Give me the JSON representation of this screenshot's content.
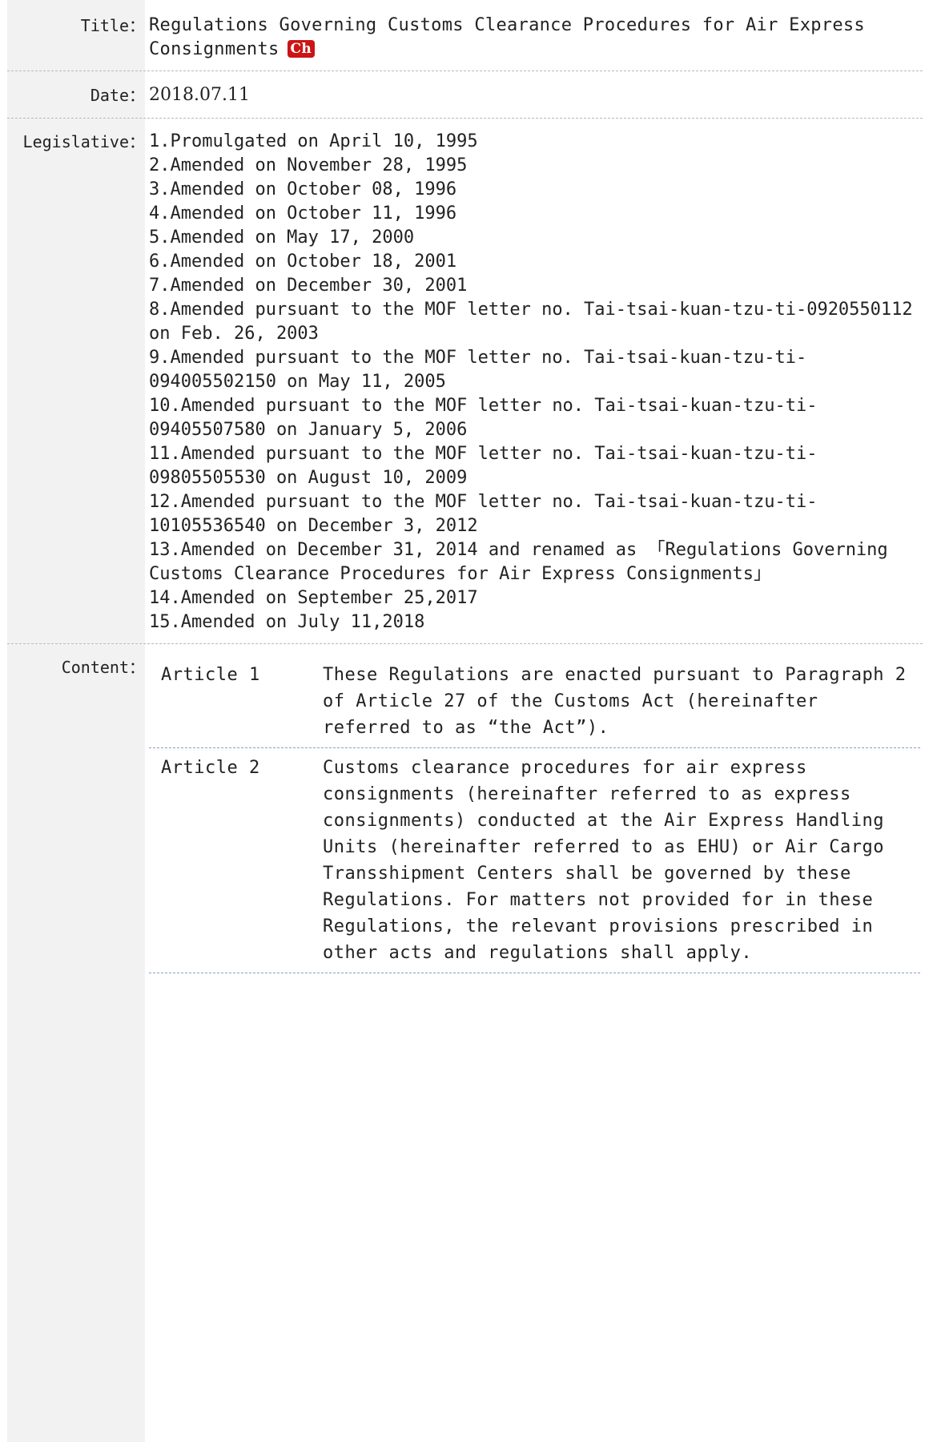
{
  "title": {
    "label": "Title：",
    "value": "Regulations Governing Customs Clearance Procedures for Air Express Consignments",
    "badge": "Ch",
    "badge_color": "#cc1414"
  },
  "date": {
    "label": "Date：",
    "value": "2018.07.11"
  },
  "legislative": {
    "label": "Legislative：",
    "items": [
      "1.Promulgated on April 10, 1995",
      "2.Amended on November 28, 1995",
      "3.Amended on October 08, 1996",
      "4.Amended on October 11, 1996",
      "5.Amended on May 17, 2000",
      "6.Amended on October 18, 2001",
      "7.Amended on December 30, 2001",
      "8.Amended pursuant to the MOF letter no. Tai-tsai-kuan-tzu-ti-0920550112 on Feb. 26, 2003",
      "9.Amended pursuant to the MOF letter no. Tai-tsai-kuan-tzu-ti-094005502150 on May 11, 2005",
      "10.Amended pursuant to the MOF letter no. Tai-tsai-kuan-tzu-ti-09405507580 on January 5, 2006",
      "11.Amended pursuant to the MOF letter no. Tai-tsai-kuan-tzu-ti-09805505530 on August 10, 2009",
      "12.Amended pursuant to the MOF letter no. Tai-tsai-kuan-tzu-ti-10105536540 on December 3, 2012",
      "13.Amended on December 31, 2014 and renamed as 「Regulations Governing Customs Clearance Procedures for Air Express Consignments」",
      "14.Amended on September 25,2017",
      "15.Amended on July 11,2018"
    ]
  },
  "content": {
    "label": "Content：",
    "articles": [
      {
        "name": "Article 1",
        "text": "These Regulations are enacted pursuant to Paragraph 2 of Article 27 of the Customs Act (hereinafter referred to as “the Act”)."
      },
      {
        "name": "Article 2",
        "text": "Customs clearance procedures for air express consignments (hereinafter referred to as express consignments) conducted at the Air Express Handling Units (hereinafter referred to as EHU) or Air Cargo Transshipment Centers shall be governed by these Regulations. For matters not provided for in these Regulations, the relevant provisions prescribed in other acts and regulations shall apply."
      }
    ]
  }
}
